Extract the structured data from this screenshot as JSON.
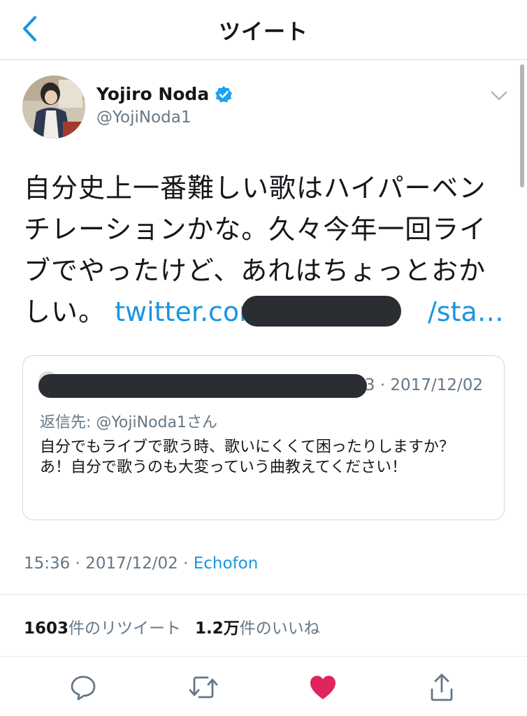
{
  "header": {
    "title": "ツイート",
    "back_icon": "chevron-left-icon"
  },
  "tweet": {
    "display_name": "Yojiro Noda",
    "verified": true,
    "handle": "@YojiNoda1",
    "text": "自分史上一番難しい歌はハイパーベンチレーションかな。久々今年一回ライブでやったけど、あれはちょっとおかしい。",
    "link_start": "twitter.com/",
    "link_end": "/sta…",
    "time": "15:36",
    "date": "2017/12/02",
    "source": "Echofon",
    "retweet_count": "1603",
    "retweet_label": "件のリツイート",
    "like_count": "1.2万",
    "like_label": "件のいいね"
  },
  "quote": {
    "date": "3 · 2017/12/02",
    "reply_to": "返信先: @YojiNoda1さん",
    "body_line1": "自分でもライブで歌う時、歌いにくくて困ったりしますか？",
    "body_line2": "あ！自分で歌うのも大変っていう曲教えてください！"
  },
  "actions": [
    {
      "name": "reply",
      "icon": "comment-icon"
    },
    {
      "name": "retweet",
      "icon": "retweet-icon"
    },
    {
      "name": "like",
      "icon": "heart-icon"
    },
    {
      "name": "share",
      "icon": "share-icon"
    }
  ],
  "colors": {
    "accent": "#1b95e0",
    "like": "#e0245e",
    "muted": "#657786",
    "text": "#14171a",
    "verified": "#1da1f2"
  }
}
